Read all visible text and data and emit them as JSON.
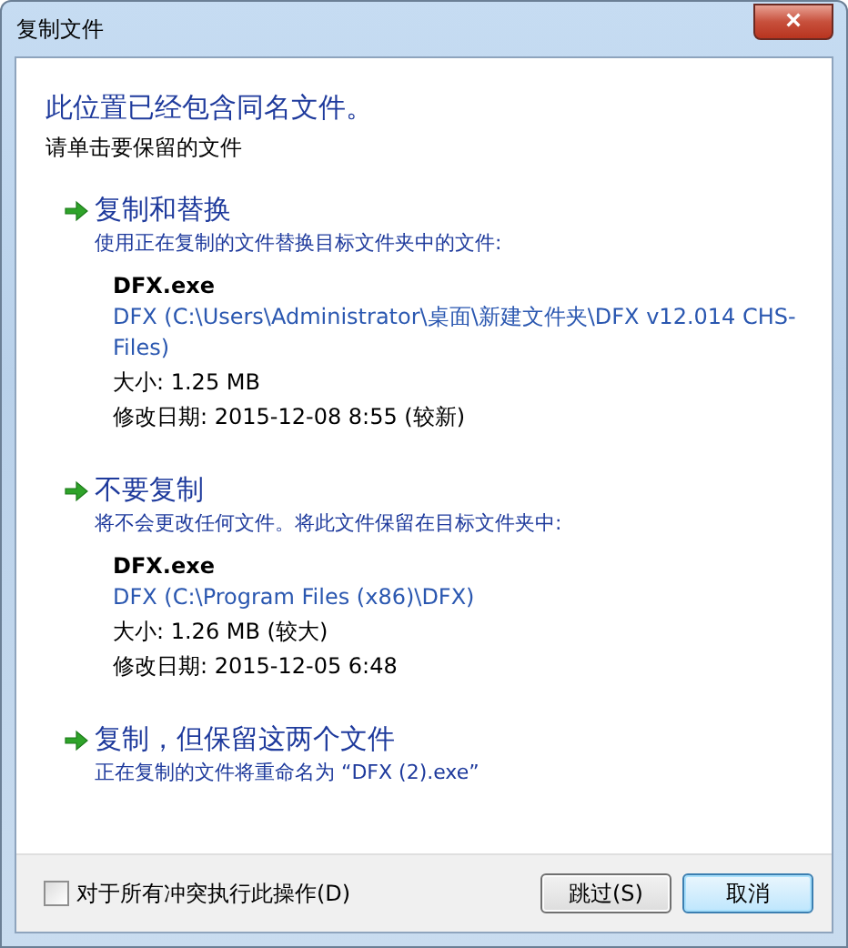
{
  "window": {
    "title": "复制文件",
    "close": "×"
  },
  "heading": "此位置已经包含同名文件。",
  "instruction": "请单击要保留的文件",
  "options": [
    {
      "title": "复制和替换",
      "description": "使用正在复制的文件替换目标文件夹中的文件:",
      "file": {
        "name": "DFX.exe",
        "path": "DFX (C:\\Users\\Administrator\\桌面\\新建文件夹\\DFX v12.014 CHS-Files)",
        "size": "大小: 1.25 MB",
        "date": "修改日期: 2015-12-08  8:55 (较新)"
      }
    },
    {
      "title": "不要复制",
      "description": "将不会更改任何文件。将此文件保留在目标文件夹中:",
      "file": {
        "name": "DFX.exe",
        "path": "DFX (C:\\Program Files (x86)\\DFX)",
        "size": "大小: 1.26 MB (较大)",
        "date": "修改日期: 2015-12-05  6:48"
      }
    },
    {
      "title": "复制，但保留这两个文件",
      "description": "正在复制的文件将重命名为 “DFX (2).exe”"
    }
  ],
  "apply_all": {
    "label": "对于所有冲突执行此操作(D)",
    "checked": false
  },
  "buttons": [
    {
      "label": "跳过(S)",
      "default": false
    },
    {
      "label": "取消",
      "default": true
    }
  ]
}
